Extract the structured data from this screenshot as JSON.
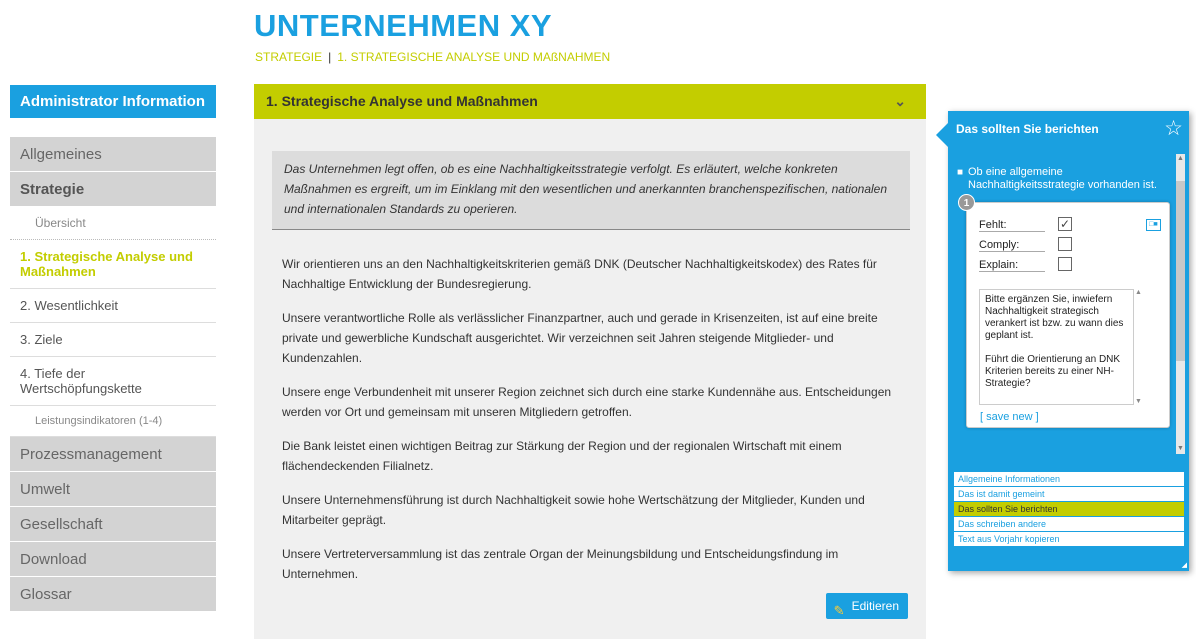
{
  "header": {
    "brand": "UNTERNEHMEN XY",
    "breadcrumb": [
      "STRATEGIE",
      "|",
      "1. STRATEGISCHE ANALYSE UND MAßNAHMEN"
    ]
  },
  "sidebar": {
    "admin_label": "Administrator Information",
    "items": [
      {
        "label": "Allgemeines"
      },
      {
        "label": "Strategie"
      },
      {
        "label": "Übersicht"
      },
      {
        "label": "1. Strategische Analyse und Maßnahmen"
      },
      {
        "label": "2. Wesentlichkeit"
      },
      {
        "label": "3. Ziele"
      },
      {
        "label": "4. Tiefe der Wertschöpfungskette"
      },
      {
        "label": "Leistungsindikatoren (1-4)"
      },
      {
        "label": "Prozessmanagement"
      },
      {
        "label": "Umwelt"
      },
      {
        "label": "Gesellschaft"
      },
      {
        "label": "Download"
      },
      {
        "label": "Glossar"
      }
    ]
  },
  "main": {
    "title": "1. Strategische Analyse und Maßnahmen",
    "intro": "Das Unternehmen legt offen, ob es eine Nachhaltigkeitsstrategie verfolgt. Es erläutert, welche konkreten Maßnahmen es ergreift, um im Einklang mit den wesentlichen und anerkannten branchenspezifischen, nationalen und internationalen Standards zu operieren.",
    "paragraphs": [
      "Wir orientieren uns an den Nachhaltigkeitskriterien gemäß DNK (Deutscher Nachhaltigkeitskodex) des Rates für Nachhaltige Entwicklung der Bundesregierung.",
      "Unsere verantwortliche Rolle als verlässlicher Finanzpartner, auch und gerade in Krisenzeiten, ist auf eine breite private und gewerbliche Kundschaft ausgerichtet. Wir verzeichnen seit Jahren steigende Mitglieder- und Kundenzahlen.",
      "Unsere enge Verbundenheit mit unserer Region zeichnet sich durch eine starke Kundennähe aus. Entscheidungen werden vor Ort und gemeinsam mit unseren Mitgliedern getroffen.",
      "Die Bank leistet einen wichtigen Beitrag zur Stärkung der Region und der regionalen Wirtschaft mit einem flächendeckenden Filialnetz.",
      "Unsere Unternehmensführung ist durch Nachhaltigkeit sowie hohe Wertschätzung der Mitglieder, Kunden und Mitarbeiter geprägt.",
      "Unsere Vertreterversammlung ist das zentrale Organ der Meinungsbildung und Entscheidungsfindung im Unternehmen."
    ],
    "edit_label": "Editieren"
  },
  "widget": {
    "title": "Das sollten Sie berichten",
    "bullet": "Ob eine allgemeine Nachhaltigkeitsstrategie vorhanden ist.",
    "card": {
      "number": "1",
      "options": [
        {
          "label": "Fehlt:",
          "checked": "✓"
        },
        {
          "label": "Comply:",
          "checked": ""
        },
        {
          "label": "Explain:",
          "checked": ""
        }
      ],
      "note_p1": "Bitte ergänzen Sie, inwiefern Nachhaltigkeit strategisch verankert ist bzw. zu wann dies geplant ist.",
      "note_p2": "Führt die Orientierung an DNK Kriterien bereits zu einer NH-Strategie?",
      "save_label": "[ save new ]"
    },
    "menu": [
      "Allgemeine Informationen",
      "Das ist damit gemeint",
      "Das sollten Sie berichten",
      "Das schreiben andere",
      "Text aus Vorjahr kopieren"
    ]
  }
}
